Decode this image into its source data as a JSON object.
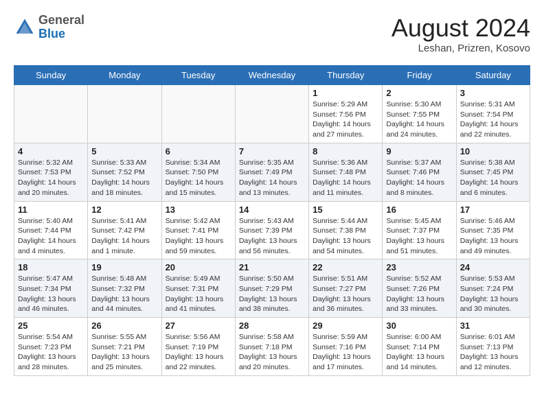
{
  "header": {
    "logo_general": "General",
    "logo_blue": "Blue",
    "month_year": "August 2024",
    "location": "Leshan, Prizren, Kosovo"
  },
  "weekdays": [
    "Sunday",
    "Monday",
    "Tuesday",
    "Wednesday",
    "Thursday",
    "Friday",
    "Saturday"
  ],
  "weeks": [
    [
      {
        "day": "",
        "info": ""
      },
      {
        "day": "",
        "info": ""
      },
      {
        "day": "",
        "info": ""
      },
      {
        "day": "",
        "info": ""
      },
      {
        "day": "1",
        "info": "Sunrise: 5:29 AM\nSunset: 7:56 PM\nDaylight: 14 hours and 27 minutes."
      },
      {
        "day": "2",
        "info": "Sunrise: 5:30 AM\nSunset: 7:55 PM\nDaylight: 14 hours and 24 minutes."
      },
      {
        "day": "3",
        "info": "Sunrise: 5:31 AM\nSunset: 7:54 PM\nDaylight: 14 hours and 22 minutes."
      }
    ],
    [
      {
        "day": "4",
        "info": "Sunrise: 5:32 AM\nSunset: 7:53 PM\nDaylight: 14 hours and 20 minutes."
      },
      {
        "day": "5",
        "info": "Sunrise: 5:33 AM\nSunset: 7:52 PM\nDaylight: 14 hours and 18 minutes."
      },
      {
        "day": "6",
        "info": "Sunrise: 5:34 AM\nSunset: 7:50 PM\nDaylight: 14 hours and 15 minutes."
      },
      {
        "day": "7",
        "info": "Sunrise: 5:35 AM\nSunset: 7:49 PM\nDaylight: 14 hours and 13 minutes."
      },
      {
        "day": "8",
        "info": "Sunrise: 5:36 AM\nSunset: 7:48 PM\nDaylight: 14 hours and 11 minutes."
      },
      {
        "day": "9",
        "info": "Sunrise: 5:37 AM\nSunset: 7:46 PM\nDaylight: 14 hours and 8 minutes."
      },
      {
        "day": "10",
        "info": "Sunrise: 5:38 AM\nSunset: 7:45 PM\nDaylight: 14 hours and 6 minutes."
      }
    ],
    [
      {
        "day": "11",
        "info": "Sunrise: 5:40 AM\nSunset: 7:44 PM\nDaylight: 14 hours and 4 minutes."
      },
      {
        "day": "12",
        "info": "Sunrise: 5:41 AM\nSunset: 7:42 PM\nDaylight: 14 hours and 1 minute."
      },
      {
        "day": "13",
        "info": "Sunrise: 5:42 AM\nSunset: 7:41 PM\nDaylight: 13 hours and 59 minutes."
      },
      {
        "day": "14",
        "info": "Sunrise: 5:43 AM\nSunset: 7:39 PM\nDaylight: 13 hours and 56 minutes."
      },
      {
        "day": "15",
        "info": "Sunrise: 5:44 AM\nSunset: 7:38 PM\nDaylight: 13 hours and 54 minutes."
      },
      {
        "day": "16",
        "info": "Sunrise: 5:45 AM\nSunset: 7:37 PM\nDaylight: 13 hours and 51 minutes."
      },
      {
        "day": "17",
        "info": "Sunrise: 5:46 AM\nSunset: 7:35 PM\nDaylight: 13 hours and 49 minutes."
      }
    ],
    [
      {
        "day": "18",
        "info": "Sunrise: 5:47 AM\nSunset: 7:34 PM\nDaylight: 13 hours and 46 minutes."
      },
      {
        "day": "19",
        "info": "Sunrise: 5:48 AM\nSunset: 7:32 PM\nDaylight: 13 hours and 44 minutes."
      },
      {
        "day": "20",
        "info": "Sunrise: 5:49 AM\nSunset: 7:31 PM\nDaylight: 13 hours and 41 minutes."
      },
      {
        "day": "21",
        "info": "Sunrise: 5:50 AM\nSunset: 7:29 PM\nDaylight: 13 hours and 38 minutes."
      },
      {
        "day": "22",
        "info": "Sunrise: 5:51 AM\nSunset: 7:27 PM\nDaylight: 13 hours and 36 minutes."
      },
      {
        "day": "23",
        "info": "Sunrise: 5:52 AM\nSunset: 7:26 PM\nDaylight: 13 hours and 33 minutes."
      },
      {
        "day": "24",
        "info": "Sunrise: 5:53 AM\nSunset: 7:24 PM\nDaylight: 13 hours and 30 minutes."
      }
    ],
    [
      {
        "day": "25",
        "info": "Sunrise: 5:54 AM\nSunset: 7:23 PM\nDaylight: 13 hours and 28 minutes."
      },
      {
        "day": "26",
        "info": "Sunrise: 5:55 AM\nSunset: 7:21 PM\nDaylight: 13 hours and 25 minutes."
      },
      {
        "day": "27",
        "info": "Sunrise: 5:56 AM\nSunset: 7:19 PM\nDaylight: 13 hours and 22 minutes."
      },
      {
        "day": "28",
        "info": "Sunrise: 5:58 AM\nSunset: 7:18 PM\nDaylight: 13 hours and 20 minutes."
      },
      {
        "day": "29",
        "info": "Sunrise: 5:59 AM\nSunset: 7:16 PM\nDaylight: 13 hours and 17 minutes."
      },
      {
        "day": "30",
        "info": "Sunrise: 6:00 AM\nSunset: 7:14 PM\nDaylight: 13 hours and 14 minutes."
      },
      {
        "day": "31",
        "info": "Sunrise: 6:01 AM\nSunset: 7:13 PM\nDaylight: 13 hours and 12 minutes."
      }
    ]
  ]
}
